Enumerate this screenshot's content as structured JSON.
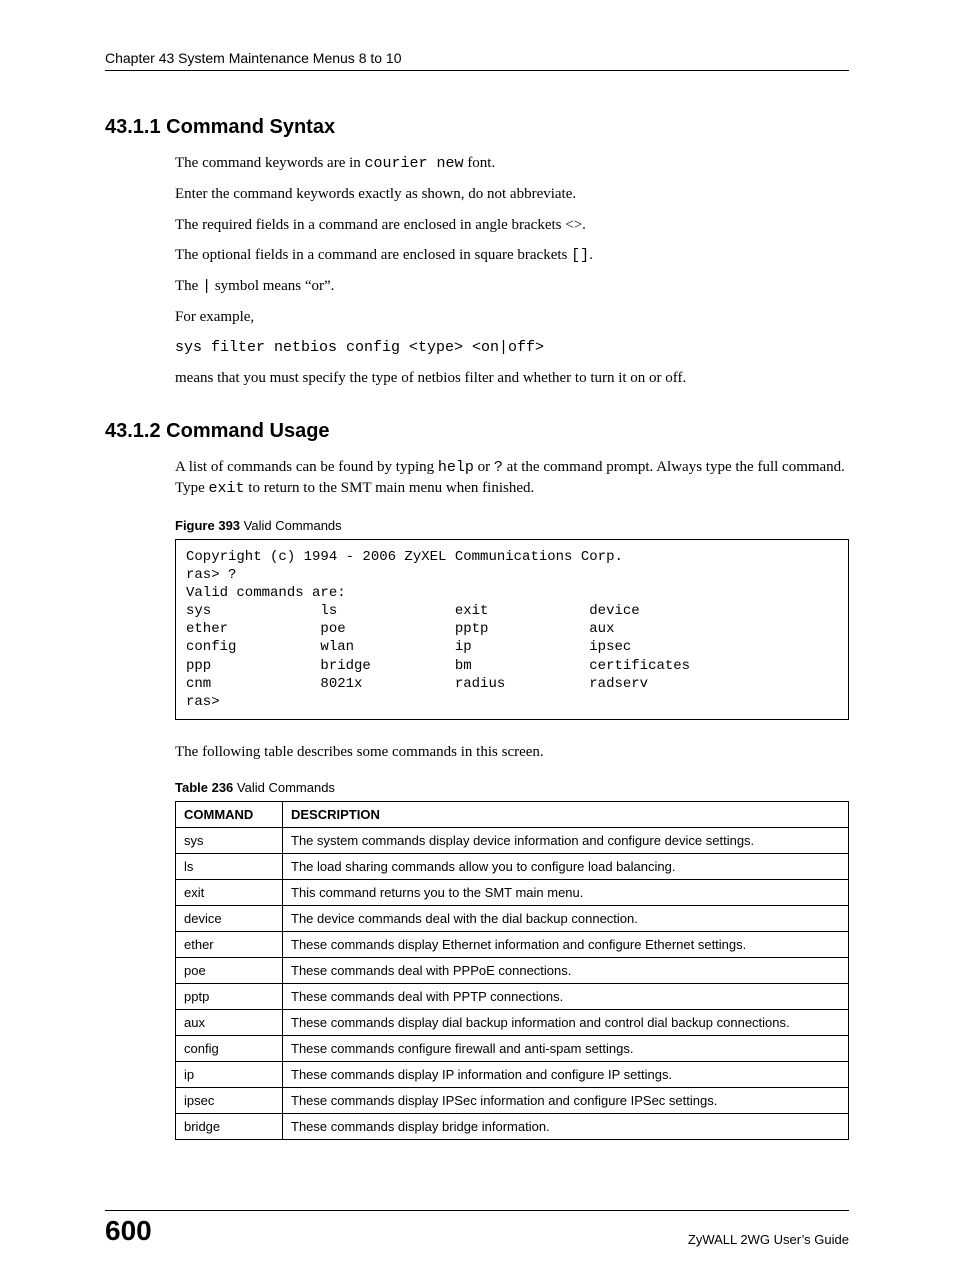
{
  "header": "Chapter 43 System Maintenance Menus 8 to 10",
  "section1": {
    "heading": "43.1.1  Command Syntax",
    "p1a": "The command keywords are in ",
    "p1b": "courier new",
    "p1c": " font.",
    "p2": "Enter the command keywords exactly as shown, do not abbreviate.",
    "p3": "The required fields in a command are enclosed in angle brackets <>.",
    "p4a": "The optional fields in a command are enclosed in square brackets ",
    "p4b": "[]",
    "p4c": ".",
    "p5a": "The ",
    "p5b": "|",
    "p5c": " symbol means “or”.",
    "p6": "For example,",
    "code": "sys filter netbios config <type> <on|off>",
    "p7": "means that you must specify the type of netbios filter and whether to turn it on or off."
  },
  "section2": {
    "heading": "43.1.2  Command Usage",
    "p1a": "A list of commands can be found by typing ",
    "p1b": "help",
    "p1c": " or ",
    "p1d": "?",
    "p1e": " at the command prompt. Always type the full command. Type ",
    "p1f": "exit",
    "p1g": " to return to the SMT main menu when finished.",
    "figure_label": "Figure 393",
    "figure_title": "   Valid Commands",
    "codebox": "Copyright (c) 1994 - 2006 ZyXEL Communications Corp.\nras> ?\nValid commands are:\nsys             ls              exit            device\nether           poe             pptp            aux\nconfig          wlan            ip              ipsec\nppp             bridge          bm              certificates\ncnm             8021x           radius          radserv\nras>",
    "p2": "The following table describes some commands in this screen.",
    "table_label": "Table 236",
    "table_title": "   Valid Commands",
    "table": {
      "head": {
        "c1": "COMMAND",
        "c2": "DESCRIPTION"
      },
      "rows": [
        {
          "c1": "sys",
          "c2": "The system commands display device information and configure device settings."
        },
        {
          "c1": "ls",
          "c2": "The load sharing commands allow you to configure load balancing."
        },
        {
          "c1": "exit",
          "c2": "This command returns you to the SMT main menu."
        },
        {
          "c1": "device",
          "c2": "The device commands deal with the dial backup connection."
        },
        {
          "c1": "ether",
          "c2": "These commands display Ethernet information and configure Ethernet settings."
        },
        {
          "c1": "poe",
          "c2": "These commands deal with PPPoE connections."
        },
        {
          "c1": "pptp",
          "c2": "These commands deal with PPTP connections."
        },
        {
          "c1": "aux",
          "c2": "These commands display dial backup information and control dial backup connections."
        },
        {
          "c1": "config",
          "c2": "These commands configure firewall and anti-spam settings."
        },
        {
          "c1": "ip",
          "c2": "These commands display IP information and configure IP settings."
        },
        {
          "c1": "ipsec",
          "c2": "These commands display IPSec information and configure IPSec settings."
        },
        {
          "c1": "bridge",
          "c2": "These commands display bridge information."
        }
      ]
    }
  },
  "footer": {
    "page": "600",
    "guide": "ZyWALL 2WG User’s Guide"
  }
}
